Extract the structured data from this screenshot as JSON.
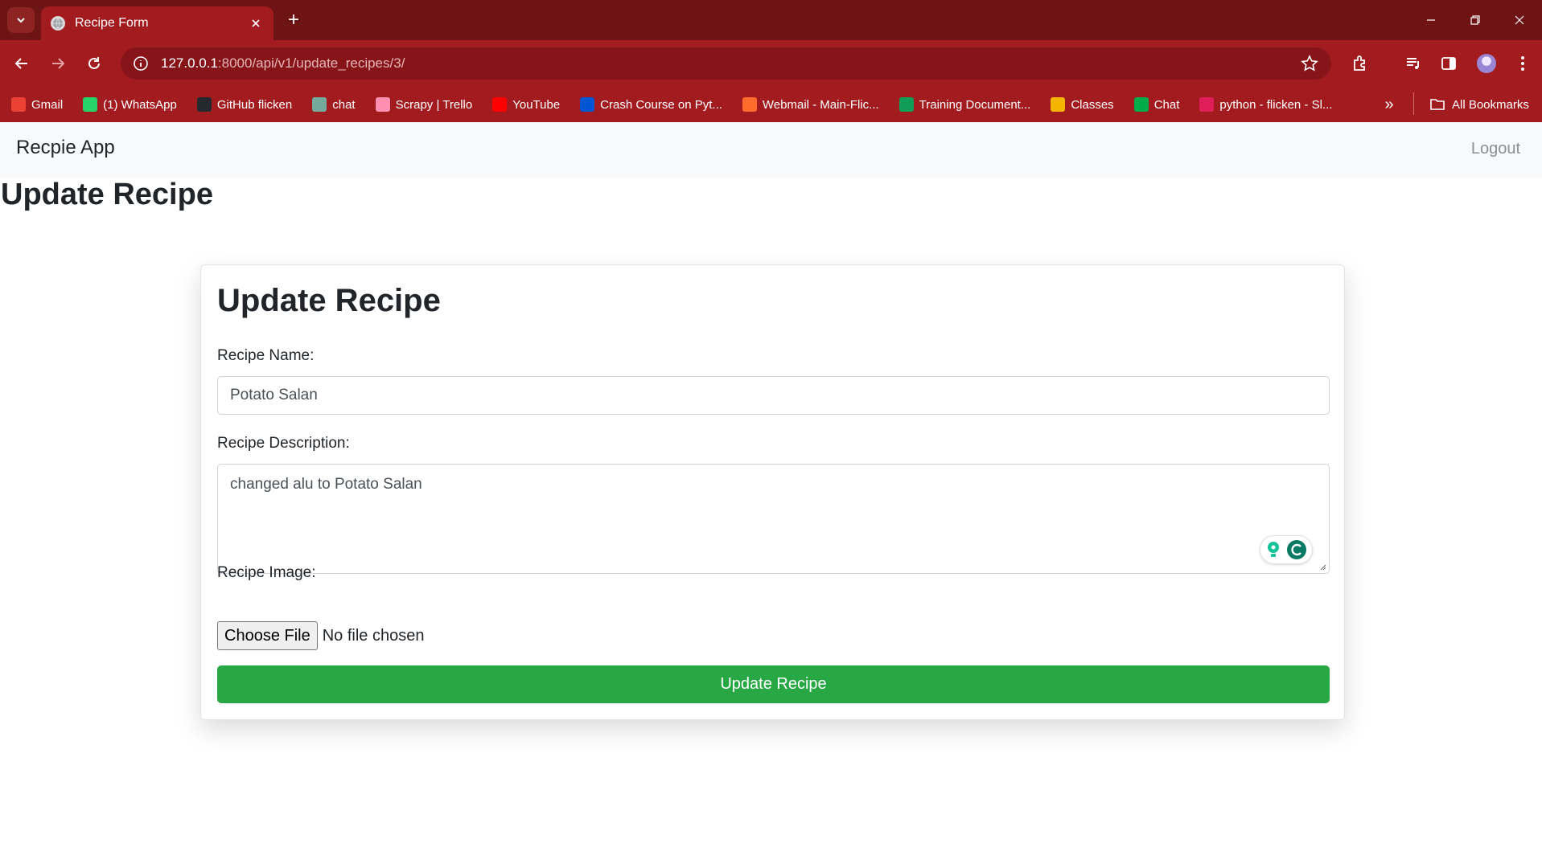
{
  "browser": {
    "tab_title": "Recipe Form",
    "new_tab_symbol": "+",
    "url_host": "127.0.0.1",
    "url_path": ":8000/api/v1/update_recipes/3/",
    "bookmarks": [
      {
        "label": "Gmail",
        "icon": "gmail-icon",
        "color": "#ea4335"
      },
      {
        "label": "(1) WhatsApp",
        "icon": "whatsapp-icon",
        "color": "#25d366"
      },
      {
        "label": "GitHub flicken",
        "icon": "github-icon",
        "color": "#24292e"
      },
      {
        "label": "chat",
        "icon": "chatgpt-icon",
        "color": "#74aa9c"
      },
      {
        "label": "Scrapy | Trello",
        "icon": "trello-icon",
        "color": "#ff8fb1"
      },
      {
        "label": "YouTube",
        "icon": "youtube-icon",
        "color": "#ff0000"
      },
      {
        "label": "Crash Course on Pyt...",
        "icon": "coursera-icon",
        "color": "#0056d2"
      },
      {
        "label": "Webmail - Main-Flic...",
        "icon": "cpanel-icon",
        "color": "#ff6c2c"
      },
      {
        "label": "Training Document...",
        "icon": "sheets-icon",
        "color": "#0f9d58"
      },
      {
        "label": "Classes",
        "icon": "classroom-icon",
        "color": "#f4b400"
      },
      {
        "label": "Chat",
        "icon": "google-chat-icon",
        "color": "#00ac47"
      },
      {
        "label": "python - flicken - Sl...",
        "icon": "slack-icon",
        "color": "#e01e5a"
      }
    ],
    "more_bookmarks_symbol": "»",
    "all_bookmarks_label": "All Bookmarks"
  },
  "app": {
    "brand": "Recpie App",
    "logout_label": "Logout",
    "page_title": "Update Recipe"
  },
  "form": {
    "title": "Update Recipe",
    "name_label": "Recipe Name:",
    "name_value": "Potato Salan",
    "description_label": "Recipe Description:",
    "description_value": "changed alu to Potato Salan",
    "image_label": "Recipe Image:",
    "choose_file_label": "Choose File",
    "file_status": "No file chosen",
    "submit_label": "Update Recipe"
  },
  "colors": {
    "chrome_frame": "#6e1414",
    "chrome_toolbar": "#a21b1f",
    "submit_green": "#28a745",
    "navbar_bg": "#f8f9fa"
  }
}
